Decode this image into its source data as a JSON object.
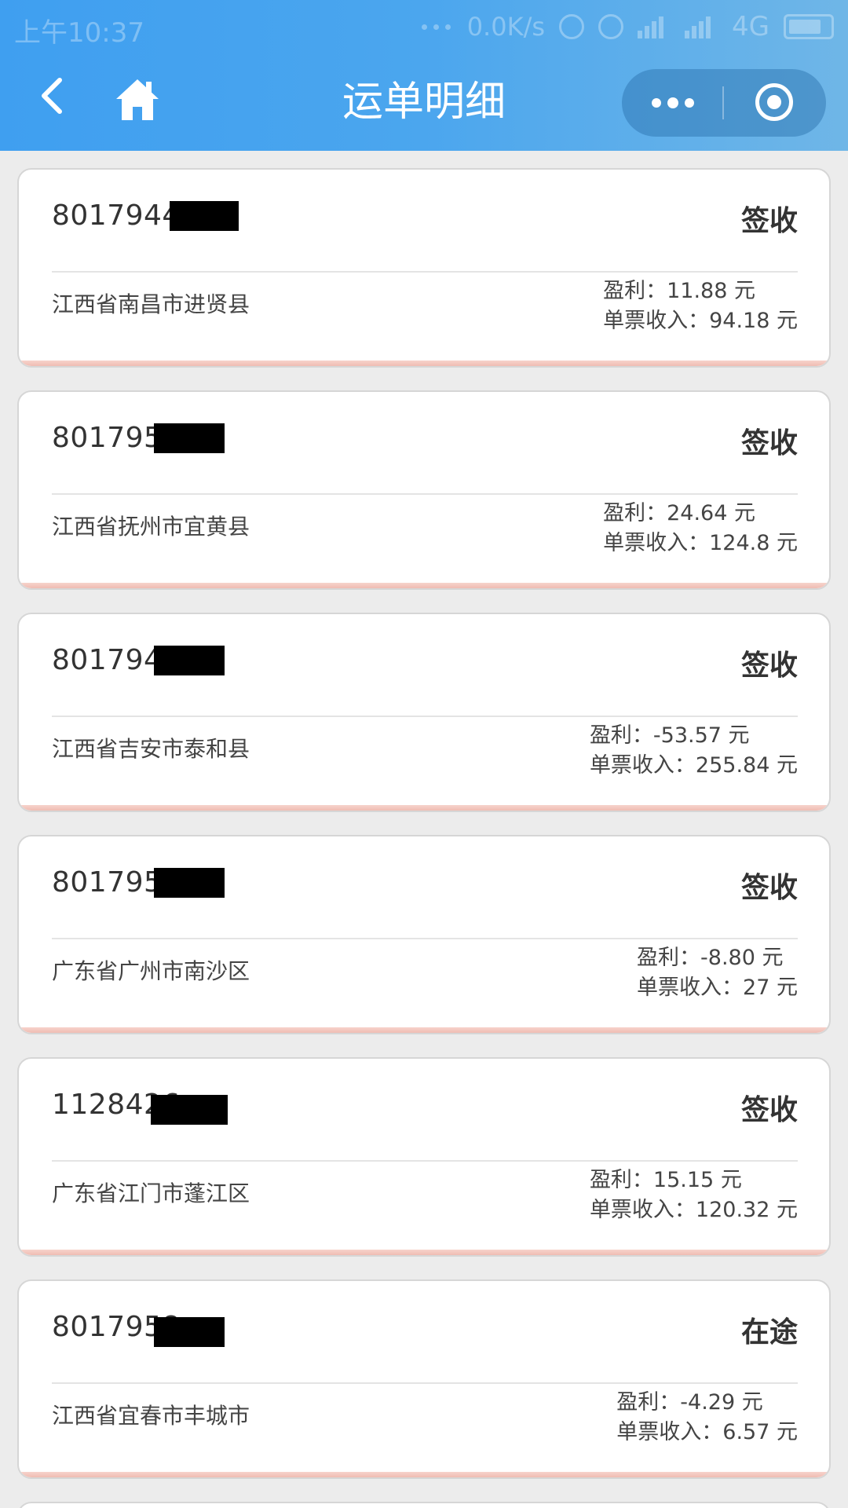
{
  "status_bar": {
    "time": "上午10:37",
    "speed": "0.0K/s",
    "network": "4G"
  },
  "nav": {
    "title": "运单明细",
    "back_icon": "chevron-left-icon",
    "home_icon": "home-icon",
    "more_icon": "more-dots-icon",
    "close_icon": "target-close-icon"
  },
  "colors": {
    "header_start": "#3f9ff0",
    "header_end": "#6fb6e7",
    "card_bottom_accent": "#efbcb2",
    "page_bg": "#ececec"
  },
  "waybills": [
    {
      "number": "80179444",
      "status": "签收",
      "address": "江西省南昌市进贤县",
      "profit": "盈利：11.88 元",
      "income": "单票收入：94.18 元"
    },
    {
      "number": "8017953",
      "status": "签收",
      "address": "江西省抚州市宜黄县",
      "profit": "盈利：24.64 元",
      "income": "单票收入：124.8 元"
    },
    {
      "number": "8017943",
      "status": "签收",
      "address": "江西省吉安市泰和县",
      "profit": "盈利：-53.57 元",
      "income": "单票收入：255.84 元"
    },
    {
      "number": "8017959",
      "status": "签收",
      "address": "广东省广州市南沙区",
      "profit": "盈利：-8.80 元",
      "income": "单票收入：27 元"
    },
    {
      "number": "1128426",
      "status": "签收",
      "address": "广东省江门市蓬江区",
      "profit": "盈利：15.15 元",
      "income": "单票收入：120.32 元"
    },
    {
      "number": "8017958",
      "status": "在途",
      "address": "江西省宜春市丰城市",
      "profit": "盈利：-4.29 元",
      "income": "单票收入：6.57 元"
    }
  ]
}
